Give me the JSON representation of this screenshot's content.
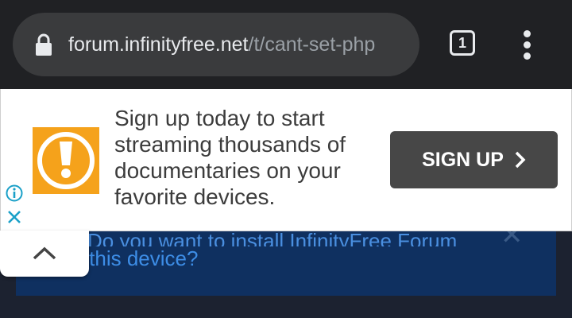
{
  "browser": {
    "url_host": "forum.infinityfree.net",
    "url_path": "/t/cant-set-php",
    "tab_count": "1",
    "icons": {
      "lock": "lock-icon",
      "menu": "more-vert-icon",
      "tabs": "tab-switcher-icon"
    }
  },
  "ad": {
    "text": "Sign up today to start streaming thousands of documentaries on your favorite devices.",
    "button_label": "SIGN UP",
    "colors": {
      "logo_bg": "#f5a21b",
      "button_bg": "#474747"
    },
    "icons": {
      "logo": "exclamation-logo-icon",
      "info": "info-icon",
      "close": "close-icon",
      "button_chevron": "chevron-right-icon"
    }
  },
  "install_banner": {
    "line1": "Do you want to install InfinityFree Forum",
    "line2": "on this device?"
  },
  "collapse": {
    "icon": "chevron-up-icon"
  }
}
